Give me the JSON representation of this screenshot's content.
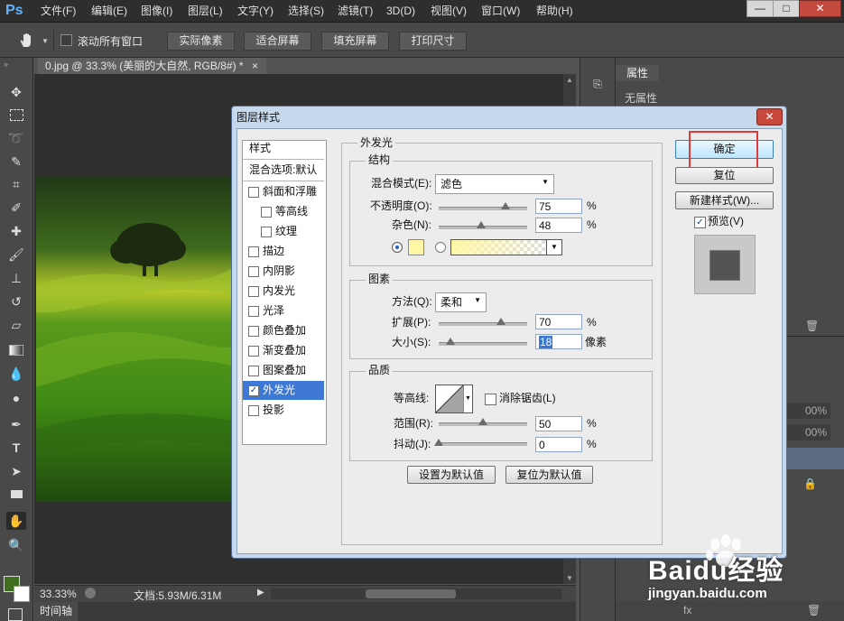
{
  "app": {
    "logo": "Ps"
  },
  "menubar": {
    "items": [
      "文件(F)",
      "编辑(E)",
      "图像(I)",
      "图层(L)",
      "文字(Y)",
      "选择(S)",
      "滤镜(T)",
      "3D(D)",
      "视图(V)",
      "窗口(W)",
      "帮助(H)"
    ],
    "window_controls": {
      "minimize": "—",
      "maximize": "□",
      "close": "✕"
    }
  },
  "options_bar": {
    "scroll_all_label": "滚动所有窗口",
    "scroll_all_checked": false,
    "buttons": [
      "实际像素",
      "适合屏幕",
      "填充屏幕",
      "打印尺寸"
    ]
  },
  "document": {
    "tab_title": "0.jpg @ 33.3% (美丽的大自然, RGB/8#) *",
    "tab_close": "×",
    "zoom": "33.33%",
    "doc_info": "文档:5.93M/6.31M"
  },
  "timeline": {
    "label": "时间轴"
  },
  "properties_panel": {
    "tab": "属性",
    "empty_text": "无属性",
    "zoom_hint_1": "00%",
    "zoom_hint_2": "00%"
  },
  "dialog": {
    "title": "图层样式",
    "close_glyph": "✕",
    "styles_header": "样式",
    "blend_options": "混合选项:默认",
    "style_items": [
      {
        "label": "斜面和浮雕",
        "checked": false,
        "indent": false,
        "selected": false
      },
      {
        "label": "等高线",
        "checked": false,
        "indent": true,
        "selected": false
      },
      {
        "label": "纹理",
        "checked": false,
        "indent": true,
        "selected": false
      },
      {
        "label": "描边",
        "checked": false,
        "indent": false,
        "selected": false
      },
      {
        "label": "内阴影",
        "checked": false,
        "indent": false,
        "selected": false
      },
      {
        "label": "内发光",
        "checked": false,
        "indent": false,
        "selected": false
      },
      {
        "label": "光泽",
        "checked": false,
        "indent": false,
        "selected": false
      },
      {
        "label": "颜色叠加",
        "checked": false,
        "indent": false,
        "selected": false
      },
      {
        "label": "渐变叠加",
        "checked": false,
        "indent": false,
        "selected": false
      },
      {
        "label": "图案叠加",
        "checked": false,
        "indent": false,
        "selected": false
      },
      {
        "label": "外发光",
        "checked": true,
        "indent": false,
        "selected": true
      },
      {
        "label": "投影",
        "checked": false,
        "indent": false,
        "selected": false
      }
    ],
    "section_title": "外发光",
    "structure": {
      "title": "结构",
      "blend_mode_label": "混合模式(E):",
      "blend_mode_value": "滤色",
      "opacity_label": "不透明度(O):",
      "opacity_value": "75",
      "opacity_unit": "%",
      "noise_label": "杂色(N):",
      "noise_value": "48",
      "noise_unit": "%",
      "glow_color": "#fff7a6"
    },
    "elements": {
      "title": "图素",
      "technique_label": "方法(Q):",
      "technique_value": "柔和",
      "spread_label": "扩展(P):",
      "spread_value": "70",
      "spread_unit": "%",
      "size_label": "大小(S):",
      "size_value": "18",
      "size_unit": "像素"
    },
    "quality": {
      "title": "品质",
      "contour_label": "等高线:",
      "antialias_label": "消除锯齿(L)",
      "antialias_checked": false,
      "range_label": "范围(R):",
      "range_value": "50",
      "range_unit": "%",
      "jitter_label": "抖动(J):",
      "jitter_value": "0",
      "jitter_unit": "%"
    },
    "make_default": "设置为默认值",
    "reset_default": "复位为默认值",
    "ok": "确定",
    "reset": "复位",
    "new_style": "新建样式(W)...",
    "preview_label": "预览(V)",
    "preview_checked": true
  },
  "watermark": {
    "brand": "Baidu经验",
    "url": "jingyan.baidu.com"
  }
}
